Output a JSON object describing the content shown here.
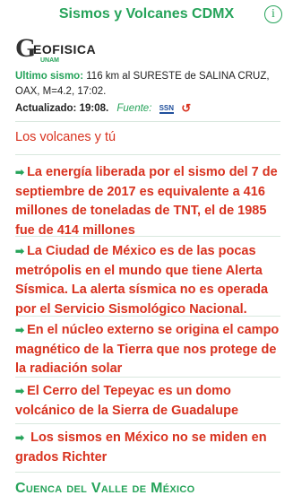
{
  "nav": {
    "title": "Sismos y Volcanes CDMX",
    "info_icon": "i"
  },
  "logo": {
    "letter": "G",
    "text": "EOFISICA",
    "sub": "UNAM"
  },
  "quake": {
    "label": "Ultimo sismo:",
    "text": "116 km al SURESTE de SALINA CRUZ, OAX, M=4.2, 17:02."
  },
  "updated": {
    "label": "Actualizado:",
    "time": "19:08.",
    "source_label": "Fuente:",
    "source_badge": "SSN",
    "refresh_icon": "↺"
  },
  "section": {
    "title": "Los volcanes y tú"
  },
  "facts": [
    {
      "arrow": "➡",
      "text": "La energía liberada por el sismo del 7 de septiembre de 2017 es equivalente a 416 millones de toneladas de TNT, el de 1985 fue de 414 millones"
    },
    {
      "arrow": "➡",
      "text": "La Ciudad de México es de las pocas metrópolis en el mundo que tiene Alerta Sísmica. La alerta sísmica no es operada por el Servicio Sismológico Nacional."
    },
    {
      "arrow": "➡",
      "text": "En el núcleo externo se origina el campo magnético de la Tierra que nos protege de la radiación solar"
    },
    {
      "arrow": "➡",
      "text": "El Cerro del Tepeyac es un domo volcánico de la Sierra de Guadalupe"
    },
    {
      "arrow": "➡",
      "text": " Los sismos en México no se miden en grados Richter"
    }
  ],
  "footer": {
    "title": "Cuenca del Valle de México"
  },
  "colors": {
    "green": "#26a35a",
    "red": "#d8321f",
    "ssn_blue": "#1f4f9c"
  }
}
